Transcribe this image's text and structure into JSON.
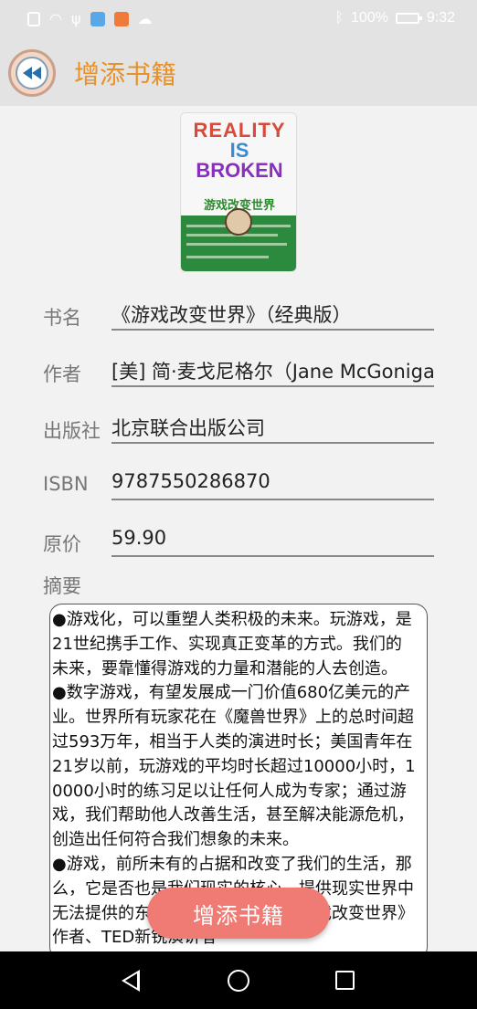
{
  "status_bar": {
    "battery_percent": "100%",
    "time": "9:32",
    "icons": [
      "sim-icon",
      "wifi-icon",
      "usb-icon",
      "app-icon",
      "video-app-icon",
      "cloud-icon",
      "bluetooth-icon",
      "battery-icon"
    ]
  },
  "app_bar": {
    "title": "增添书籍",
    "back_icon": "rewind-back-icon"
  },
  "book_cover": {
    "title_line1": "REALITY",
    "title_line2": "IS",
    "title_line3": "BROKEN",
    "cn_title": "游戏改变世界"
  },
  "form": {
    "title_label": "书名",
    "title_value": "《游戏改变世界》（经典版）",
    "author_label": "作者",
    "author_value": "[美] 简·麦戈尼格尔（Jane McGonigal）",
    "publisher_label": "出版社",
    "publisher_value": "北京联合出版公司",
    "isbn_label": "ISBN",
    "isbn_value": "9787550286870",
    "price_label": "原价",
    "price_value": "59.90",
    "abstract_label": "摘要",
    "abstract_value": "●游戏化，可以重塑人类积极的未来。玩游戏，是21世纪携手工作、实现真正变革的方式。我们的未来，要靠懂得游戏的力量和潜能的人去创造。\n●数字游戏，有望发展成一门价值680亿美元的产业。世界所有玩家花在《魔兽世界》上的总时间超过593万年，相当于人类的演进时长；美国青年在21岁以前，玩游戏的平均时长超过10000小时，10000小时的练习足以让任何人成为专家；通过游戏，我们帮助他人改善生活，甚至解决能源危机，创造出任何符合我们想象的未来。\n●游戏，前所未有的占据和改变了我们的生活，那么，它是否也是我们现实的核心，提供现实世界中无法提供的东西：宏伟的意义？《游戏改变世界》作者、TED新锐演讲者"
  },
  "actions": {
    "add_label": "增添书籍"
  },
  "colors": {
    "title_orange": "#e8902a",
    "button_red": "#f07a74",
    "app_bar_bg": "#e3e3e3"
  }
}
